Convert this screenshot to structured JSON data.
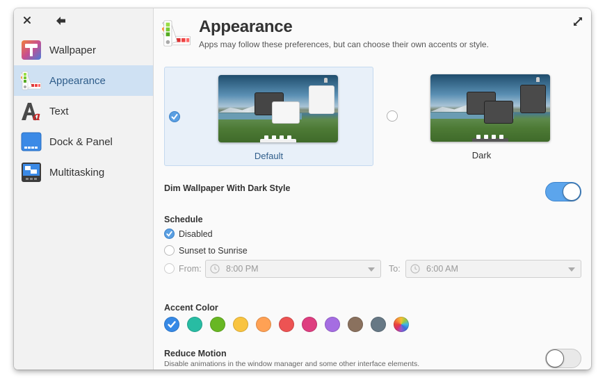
{
  "sidebar": {
    "close_icon": "close-icon",
    "back_icon": "arrow-left-icon",
    "items": [
      {
        "label": "Wallpaper",
        "icon": "paint-roller-icon",
        "active": false
      },
      {
        "label": "Appearance",
        "icon": "color-palette-icon",
        "active": true
      },
      {
        "label": "Text",
        "icon": "font-icon",
        "active": false
      },
      {
        "label": "Dock & Panel",
        "icon": "dock-icon",
        "active": false
      },
      {
        "label": "Multitasking",
        "icon": "multitasking-icon",
        "active": false
      }
    ]
  },
  "header": {
    "title": "Appearance",
    "subtitle": "Apps may follow these preferences, but can choose their own accents or style.",
    "icon": "color-palette-icon",
    "expand_icon": "expand-icon"
  },
  "style_options": [
    {
      "label": "Default",
      "selected": true
    },
    {
      "label": "Dark",
      "selected": false
    }
  ],
  "dim_wallpaper": {
    "label": "Dim Wallpaper With Dark Style",
    "enabled": true
  },
  "schedule": {
    "label": "Schedule",
    "options": [
      {
        "label": "Disabled",
        "selected": true
      },
      {
        "label": "Sunset to Sunrise",
        "selected": false
      },
      {
        "label": "From:",
        "selected": false
      }
    ],
    "from_value": "8:00 PM",
    "to_label": "To:",
    "to_value": "6:00 AM"
  },
  "accent": {
    "label": "Accent Color",
    "colors": [
      {
        "name": "blue",
        "hex": "#3689e6",
        "selected": true
      },
      {
        "name": "mint",
        "hex": "#28bca3",
        "selected": false
      },
      {
        "name": "green",
        "hex": "#68b723",
        "selected": false
      },
      {
        "name": "yellow",
        "hex": "#f9c440",
        "selected": false
      },
      {
        "name": "orange",
        "hex": "#ffa154",
        "selected": false
      },
      {
        "name": "red",
        "hex": "#ed5353",
        "selected": false
      },
      {
        "name": "pink",
        "hex": "#de3e80",
        "selected": false
      },
      {
        "name": "purple",
        "hex": "#a56de2",
        "selected": false
      },
      {
        "name": "brown",
        "hex": "#8a715e",
        "selected": false
      },
      {
        "name": "gray",
        "hex": "#667885",
        "selected": false
      },
      {
        "name": "auto",
        "hex": "multicolor",
        "selected": false
      }
    ]
  },
  "reduce_motion": {
    "label": "Reduce Motion",
    "description": "Disable animations in the window manager and some other interface elements.",
    "enabled": false
  }
}
